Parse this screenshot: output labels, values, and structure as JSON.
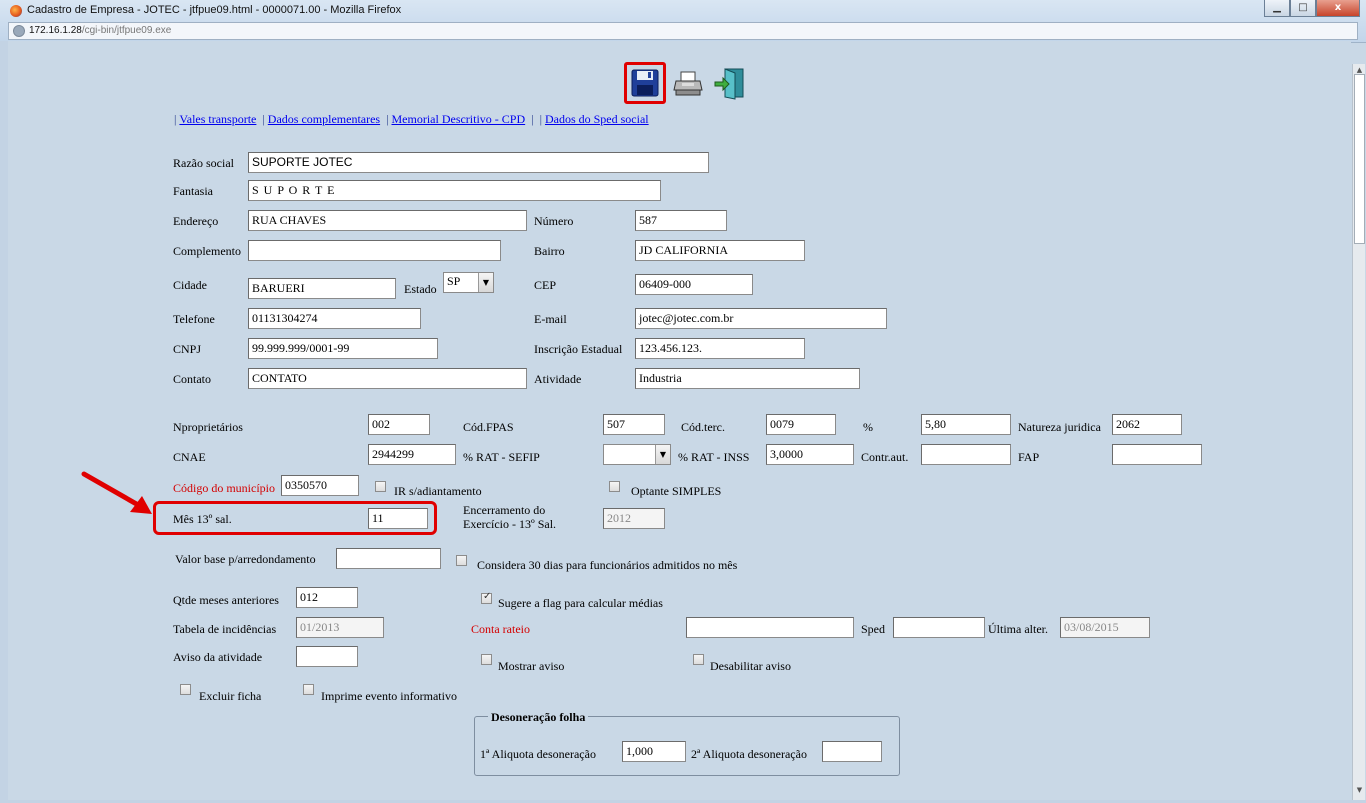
{
  "window": {
    "title": "Cadastro de Empresa - JOTEC - jtfpue09.html - 0000071.00 - Mozilla Firefox",
    "url_host": "172.16.1.28",
    "url_path": "/cgi-bin/jtfpue09.exe",
    "minimize_glyph": "▁",
    "maximize_glyph": "□",
    "close_glyph": "x"
  },
  "toolbar": {
    "save_icon": "floppy-disk-icon",
    "print_icon": "printer-icon",
    "exit_icon": "exit-door-icon"
  },
  "nav": {
    "links": [
      "Vales transporte",
      "Dados complementares",
      "Memorial Descritivo - CPD",
      "Dados do Sped social"
    ],
    "separator": "|"
  },
  "company": {
    "razao_social_label": "Razão social",
    "razao_social": "SUPORTE  JOTEC",
    "fantasia_label": "Fantasia",
    "fantasia": "S U P O R T E",
    "endereco_label": "Endereço",
    "endereco": "RUA CHAVES",
    "numero_label": "Número",
    "numero": "587",
    "complemento_label": "Complemento",
    "complemento": "",
    "bairro_label": "Bairro",
    "bairro": "JD CALIFORNIA",
    "cidade_label": "Cidade",
    "cidade": "BARUERI",
    "estado_label": "Estado",
    "estado": "SP",
    "cep_label": "CEP",
    "cep": "06409-000",
    "telefone_label": "Telefone",
    "telefone": "01131304274",
    "email_label": "E-mail",
    "email": "jotec@jotec.com.br",
    "cnpj_label": "CNPJ",
    "cnpj": "99.999.999/0001-99",
    "ie_label": "Inscrição Estadual",
    "ie": "123.456.123.",
    "contato_label": "Contato",
    "contato": "CONTATO",
    "atividade_label": "Atividade",
    "atividade": "Industria"
  },
  "fiscal": {
    "nproprietarios_label": "Nproprietários",
    "nproprietarios": "002",
    "cod_fpas_label": "Cód.FPAS",
    "cod_fpas": "507",
    "cod_terc_label": "Cód.terc.",
    "cod_terc": "0079",
    "pct_label": "%",
    "pct": "5,80",
    "natureza_label": "Natureza juridica",
    "natureza": "2062",
    "cnae_label": "CNAE",
    "cnae": "2944299",
    "rat_sefip_label": "% RAT - SEFIP",
    "rat_sefip": "",
    "rat_inss_label": "% RAT - INSS",
    "rat_inss": "3,0000",
    "contr_aut_label": "Contr.aut.",
    "contr_aut": "",
    "fap_label": "FAP",
    "fap": "",
    "cod_municipio_label": "Código do município",
    "cod_municipio": "0350570",
    "ir_label": "IR s/adiantamento",
    "simples_label": "Optante SIMPLES",
    "mes13_label": "Mês 13º sal.",
    "mes13": "11",
    "encerramento_label_1": "Encerramento do",
    "encerramento_label_2": "Exercício - 13º Sal.",
    "encerramento": "2012",
    "valor_base_label": "Valor base p/arredondamento",
    "valor_base": "",
    "considera30_label": "Considera 30 dias para funcionários admitidos no mês",
    "qtde_meses_label": "Qtde meses anteriores",
    "qtde_meses": "012",
    "sugere_label": "Sugere a flag para calcular médias",
    "tabela_label": "Tabela de incidências",
    "tabela": "01/2013",
    "conta_rateio_label": "Conta rateio",
    "conta_rateio": "",
    "sped_label": "Sped",
    "sped": "",
    "ultima_label": "Última alter.",
    "ultima": "03/08/2015",
    "aviso_label": "Aviso da atividade",
    "aviso": "",
    "mostrar_aviso_label": "Mostrar aviso",
    "desabilitar_label": "Desabilitar aviso",
    "excluir_label": "Excluir ficha",
    "imprime_label": "Imprime evento informativo"
  },
  "desoneracao": {
    "legend": "Desoneração folha",
    "aliq1_label": "1ª Aliquota desoneração",
    "aliq1": "1,000",
    "aliq2_label": "2ª Aliquota desoneração",
    "aliq2": ""
  },
  "colors": {
    "highlight": "#e00000",
    "page_bg": "#c9d8e6",
    "label_red": "#d40000"
  }
}
